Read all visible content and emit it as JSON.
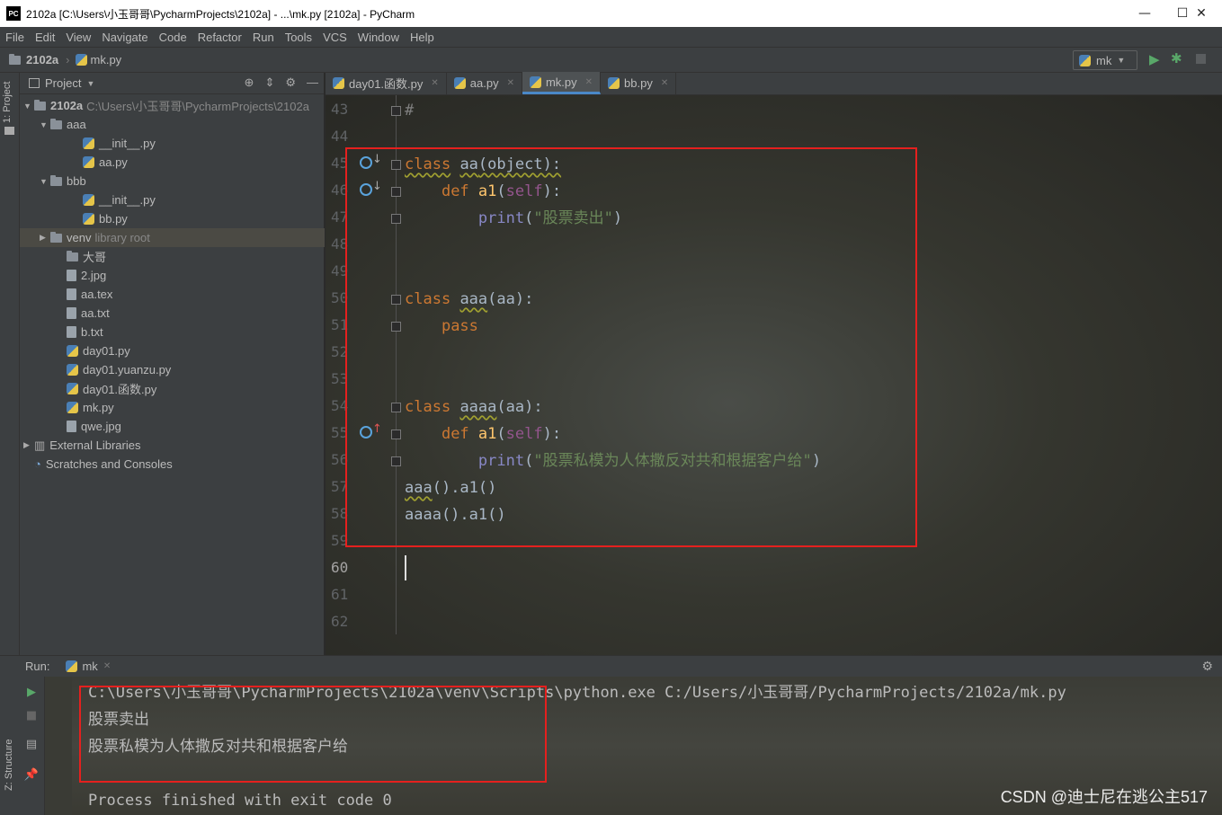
{
  "window": {
    "title": "2102a [C:\\Users\\小玉哥哥\\PycharmProjects\\2102a] - ...\\mk.py [2102a] - PyCharm",
    "app_icon_text": "PC",
    "minimize": "—",
    "maximize": "☐",
    "close": "✕"
  },
  "menu": [
    "File",
    "Edit",
    "View",
    "Navigate",
    "Code",
    "Refactor",
    "Run",
    "Tools",
    "VCS",
    "Window",
    "Help"
  ],
  "navbar": {
    "project": "2102a",
    "file": "mk.py",
    "run_config": "mk"
  },
  "left_strip": {
    "project_tab": "1: Project",
    "structure_tab": "Z: Structure"
  },
  "project_panel": {
    "title": "Project",
    "tree": [
      {
        "label": "2102a",
        "extra": "C:\\Users\\小玉哥哥\\PycharmProjects\\2102a",
        "type": "folder",
        "indent": 0,
        "arrow": "▼"
      },
      {
        "label": "aaa",
        "extra": "",
        "type": "folder",
        "indent": 1,
        "arrow": "▼"
      },
      {
        "label": "__init__.py",
        "extra": "",
        "type": "py",
        "indent": 3,
        "arrow": ""
      },
      {
        "label": "aa.py",
        "extra": "",
        "type": "py",
        "indent": 3,
        "arrow": ""
      },
      {
        "label": "bbb",
        "extra": "",
        "type": "folder",
        "indent": 1,
        "arrow": "▼"
      },
      {
        "label": "__init__.py",
        "extra": "",
        "type": "py",
        "indent": 3,
        "arrow": ""
      },
      {
        "label": "bb.py",
        "extra": "",
        "type": "py",
        "indent": 3,
        "arrow": ""
      },
      {
        "label": "venv",
        "extra": "library root",
        "type": "folder",
        "indent": 1,
        "arrow": "▶"
      },
      {
        "label": "大哥",
        "extra": "",
        "type": "folder",
        "indent": 2,
        "arrow": ""
      },
      {
        "label": "2.jpg",
        "extra": "",
        "type": "file",
        "indent": 2,
        "arrow": ""
      },
      {
        "label": "aa.tex",
        "extra": "",
        "type": "file",
        "indent": 2,
        "arrow": ""
      },
      {
        "label": "aa.txt",
        "extra": "",
        "type": "file",
        "indent": 2,
        "arrow": ""
      },
      {
        "label": "b.txt",
        "extra": "",
        "type": "file",
        "indent": 2,
        "arrow": ""
      },
      {
        "label": "day01.py",
        "extra": "",
        "type": "py",
        "indent": 2,
        "arrow": ""
      },
      {
        "label": "day01.yuanzu.py",
        "extra": "",
        "type": "py",
        "indent": 2,
        "arrow": ""
      },
      {
        "label": "day01.函数.py",
        "extra": "",
        "type": "py",
        "indent": 2,
        "arrow": ""
      },
      {
        "label": "mk.py",
        "extra": "",
        "type": "py",
        "indent": 2,
        "arrow": ""
      },
      {
        "label": "qwe.jpg",
        "extra": "",
        "type": "file",
        "indent": 2,
        "arrow": ""
      },
      {
        "label": "External Libraries",
        "extra": "",
        "type": "lib",
        "indent": 0,
        "arrow": "▶"
      },
      {
        "label": "Scratches and Consoles",
        "extra": "",
        "type": "scratch",
        "indent": 0,
        "arrow": ""
      }
    ]
  },
  "tabs": [
    {
      "label": "day01.函数.py",
      "active": false
    },
    {
      "label": "aa.py",
      "active": false
    },
    {
      "label": "mk.py",
      "active": true
    },
    {
      "label": "bb.py",
      "active": false
    }
  ],
  "editor": {
    "line_numbers": [
      "43",
      "44",
      "45",
      "46",
      "47",
      "48",
      "49",
      "50",
      "51",
      "52",
      "53",
      "54",
      "55",
      "56",
      "57",
      "58",
      "59",
      "60",
      "61",
      "62"
    ],
    "code": {
      "l43": "#",
      "l45_kw": "class",
      "l45_name": "aa",
      "l45_rest": "(object):",
      "l46_kw": "def",
      "l46_fn": "a1",
      "l46_p1": "(",
      "l46_self": "self",
      "l46_p2": "):",
      "l47_fn": "print",
      "l47_p1": "(",
      "l47_str": "\"股票卖出\"",
      "l47_p2": ")",
      "l50_kw": "class",
      "l50_name": "aaa",
      "l50_rest": "(aa):",
      "l51_kw": "pass",
      "l54_kw": "class",
      "l54_name": "aaaa",
      "l54_rest": "(aa):",
      "l55_kw": "def",
      "l55_fn": "a1",
      "l55_p1": "(",
      "l55_self": "self",
      "l55_p2": "):",
      "l56_fn": "print",
      "l56_p1": "(",
      "l56_str": "\"股票私模为人体撒反对共和根据客户给\"",
      "l56_p2": ")",
      "l57_a": "aaa",
      "l57_b": "().a1()",
      "l58": "aaaa().a1()"
    }
  },
  "run": {
    "label": "Run:",
    "config": "mk",
    "output": [
      "C:\\Users\\小玉哥哥\\PycharmProjects\\2102a\\venv\\Scripts\\python.exe C:/Users/小玉哥哥/PycharmProjects/2102a/mk.py",
      "股票卖出",
      "股票私模为人体撒反对共和根据客户给",
      "",
      "Process finished with exit code 0"
    ]
  },
  "watermark": "CSDN @迪士尼在逃公主517",
  "colors": {
    "highlight_box": "#e5201e",
    "keyword": "#cc7832",
    "function": "#ffc66d",
    "string": "#6a8759",
    "self": "#94558d"
  }
}
